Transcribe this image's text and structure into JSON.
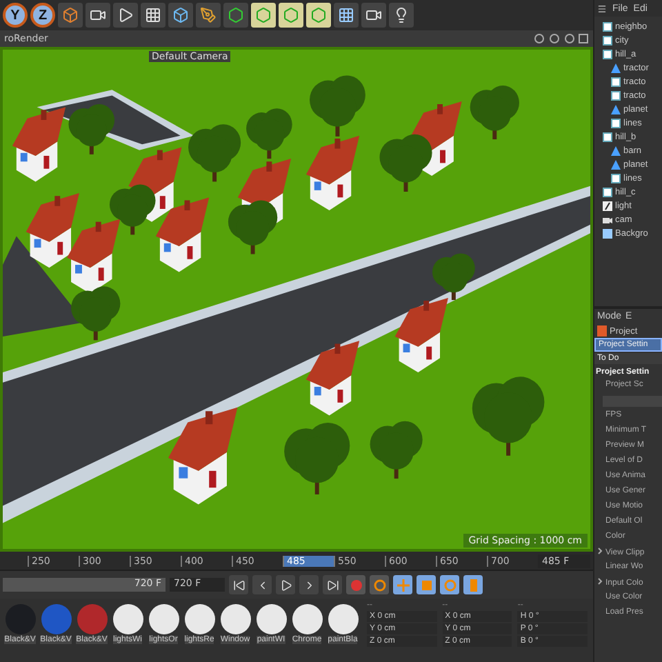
{
  "toolbar": {
    "axis_buttons": [
      "Y",
      "Z"
    ]
  },
  "viewport": {
    "menu_label": "roRender",
    "camera_label": "Default Camera",
    "grid_label": "Grid Spacing : 1000 cm"
  },
  "timeline": {
    "ticks": [
      {
        "label": "250",
        "selected": false
      },
      {
        "label": "300",
        "selected": false
      },
      {
        "label": "350",
        "selected": false
      },
      {
        "label": "400",
        "selected": false
      },
      {
        "label": "450",
        "selected": false
      },
      {
        "label": "485",
        "selected": true
      },
      {
        "label": "550",
        "selected": false
      },
      {
        "label": "600",
        "selected": false
      },
      {
        "label": "650",
        "selected": false
      },
      {
        "label": "700",
        "selected": false
      }
    ],
    "current_frame": "485 F"
  },
  "transport": {
    "range_end": "720 F",
    "max_frame": "720 F"
  },
  "materials": [
    {
      "name": "Black&V",
      "color": "#1b1d22"
    },
    {
      "name": "Black&V",
      "color": "#1f56c4"
    },
    {
      "name": "Black&V",
      "color": "#b0282b"
    },
    {
      "name": "lightsWi",
      "color": "#e8e8e8"
    },
    {
      "name": "lightsOr",
      "color": "#e8e8e8"
    },
    {
      "name": "lightsRe",
      "color": "#e8e8e8"
    },
    {
      "name": "Window",
      "color": "#e8e8e8"
    },
    {
      "name": "paintWI",
      "color": "#e8e8e8"
    },
    {
      "name": "Chrome",
      "color": "#e8e8e8"
    },
    {
      "name": "paintBla",
      "color": "#e8e8e8"
    }
  ],
  "coordinates": {
    "headers": [
      "--",
      "--",
      "--"
    ],
    "rows": [
      {
        "axis": "X",
        "value": "0 cm",
        "axis2": "X",
        "value2": "0 cm",
        "rot": "H",
        "rot_value": "0 °"
      },
      {
        "axis": "Y",
        "value": "0 cm",
        "axis2": "Y",
        "value2": "0 cm",
        "rot": "P",
        "rot_value": "0 °"
      },
      {
        "axis": "Z",
        "value": "0 cm",
        "axis2": "Z",
        "value2": "0 cm",
        "rot": "B",
        "rot_value": "0 °"
      }
    ]
  },
  "objects": {
    "menu": [
      "File",
      "Edi"
    ],
    "items": [
      {
        "name": "neighbo",
        "kind": "null"
      },
      {
        "name": "city",
        "kind": "null"
      },
      {
        "name": "hill_a",
        "kind": "null",
        "children": [
          {
            "name": "tractor",
            "kind": "polygon"
          },
          {
            "name": "tracto",
            "kind": "null"
          },
          {
            "name": "tracto",
            "kind": "null"
          },
          {
            "name": "planet",
            "kind": "polygon"
          },
          {
            "name": "lines",
            "kind": "null"
          }
        ]
      },
      {
        "name": "hill_b",
        "kind": "null",
        "children": [
          {
            "name": "barn",
            "kind": "polygon"
          },
          {
            "name": "planet",
            "kind": "polygon"
          },
          {
            "name": "lines",
            "kind": "null"
          }
        ]
      },
      {
        "name": "hill_c",
        "kind": "null"
      },
      {
        "name": "light",
        "kind": "light"
      },
      {
        "name": "cam",
        "kind": "camera"
      },
      {
        "name": "Backgro",
        "kind": "background"
      }
    ]
  },
  "attributes": {
    "menu": [
      "Mode",
      "E"
    ],
    "object": "Project",
    "tabs": [
      {
        "label": "Project Settin",
        "selected": true
      },
      {
        "label": "To Do",
        "selected": false
      }
    ],
    "heading": "Project Settin",
    "fields": [
      {
        "kind": "label",
        "label": "Project Sc"
      },
      {
        "kind": "bar"
      },
      {
        "kind": "label",
        "label": "FPS"
      },
      {
        "kind": "label",
        "label": "Minimum T"
      },
      {
        "kind": "label",
        "label": "Preview M"
      },
      {
        "kind": "label",
        "label": "Level of D"
      },
      {
        "kind": "label",
        "label": "Use Anima"
      },
      {
        "kind": "label",
        "label": "Use Gener"
      },
      {
        "kind": "label",
        "label": "Use Motio"
      },
      {
        "kind": "label",
        "label": "Default Ol"
      },
      {
        "kind": "label",
        "label": "Color"
      },
      {
        "kind": "group",
        "label": "View Clipp"
      },
      {
        "kind": "label",
        "label": "Linear Wo"
      },
      {
        "kind": "group",
        "label": "Input Colo"
      },
      {
        "kind": "label",
        "label": "Use Color"
      },
      {
        "kind": "label",
        "label": "Load Pres"
      }
    ]
  }
}
